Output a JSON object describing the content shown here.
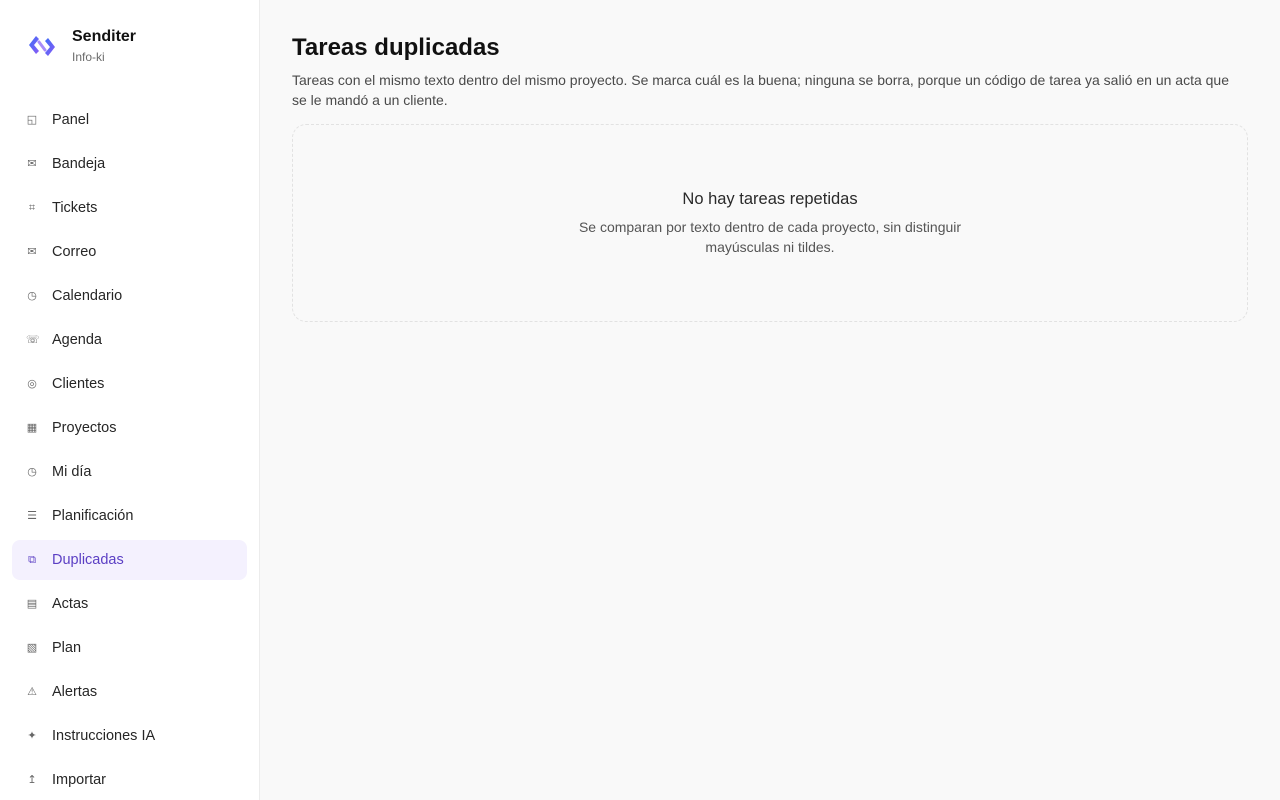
{
  "brand": {
    "name": "Senditer",
    "subtitle": "Info-ki"
  },
  "sidebar": {
    "items": [
      {
        "label": "Panel",
        "icon": "panel-icon",
        "glyph": "◱",
        "active": false
      },
      {
        "label": "Bandeja",
        "icon": "inbox-icon",
        "glyph": "✉",
        "active": false
      },
      {
        "label": "Tickets",
        "icon": "ticket-icon",
        "glyph": "⌗",
        "active": false
      },
      {
        "label": "Correo",
        "icon": "mail-icon",
        "glyph": "✉",
        "active": false
      },
      {
        "label": "Calendario",
        "icon": "clock-icon",
        "glyph": "◷",
        "active": false
      },
      {
        "label": "Agenda",
        "icon": "phone-icon",
        "glyph": "☏",
        "active": false
      },
      {
        "label": "Clientes",
        "icon": "clients-icon",
        "glyph": "◎",
        "active": false
      },
      {
        "label": "Proyectos",
        "icon": "grid-icon",
        "glyph": "▦",
        "active": false
      },
      {
        "label": "Mi día",
        "icon": "clock-icon",
        "glyph": "◷",
        "active": false
      },
      {
        "label": "Planificación",
        "icon": "list-icon",
        "glyph": "☰",
        "active": false
      },
      {
        "label": "Duplicadas",
        "icon": "duplicate-icon",
        "glyph": "⧉",
        "active": true
      },
      {
        "label": "Actas",
        "icon": "document-icon",
        "glyph": "▤",
        "active": false
      },
      {
        "label": "Plan",
        "icon": "plan-icon",
        "glyph": "▧",
        "active": false
      },
      {
        "label": "Alertas",
        "icon": "warning-icon",
        "glyph": "⚠",
        "active": false
      },
      {
        "label": "Instrucciones IA",
        "icon": "sparkle-icon",
        "glyph": "✦",
        "active": false
      },
      {
        "label": "Importar",
        "icon": "import-icon",
        "glyph": "↥",
        "active": false
      }
    ]
  },
  "main": {
    "title": "Tareas duplicadas",
    "description": "Tareas con el mismo texto dentro del mismo proyecto. Se marca cuál es la buena; ninguna se borra, porque un código de tarea ya salió en un acta que se le mandó a un cliente.",
    "empty": {
      "title": "No hay tareas repetidas",
      "subtitle": "Se comparan por texto dentro de cada proyecto, sin distinguir mayúsculas ni tildes."
    }
  },
  "colors": {
    "accent": "#5b3fc4",
    "active_bg": "#f4f1fe",
    "background": "#f9f9f9"
  }
}
